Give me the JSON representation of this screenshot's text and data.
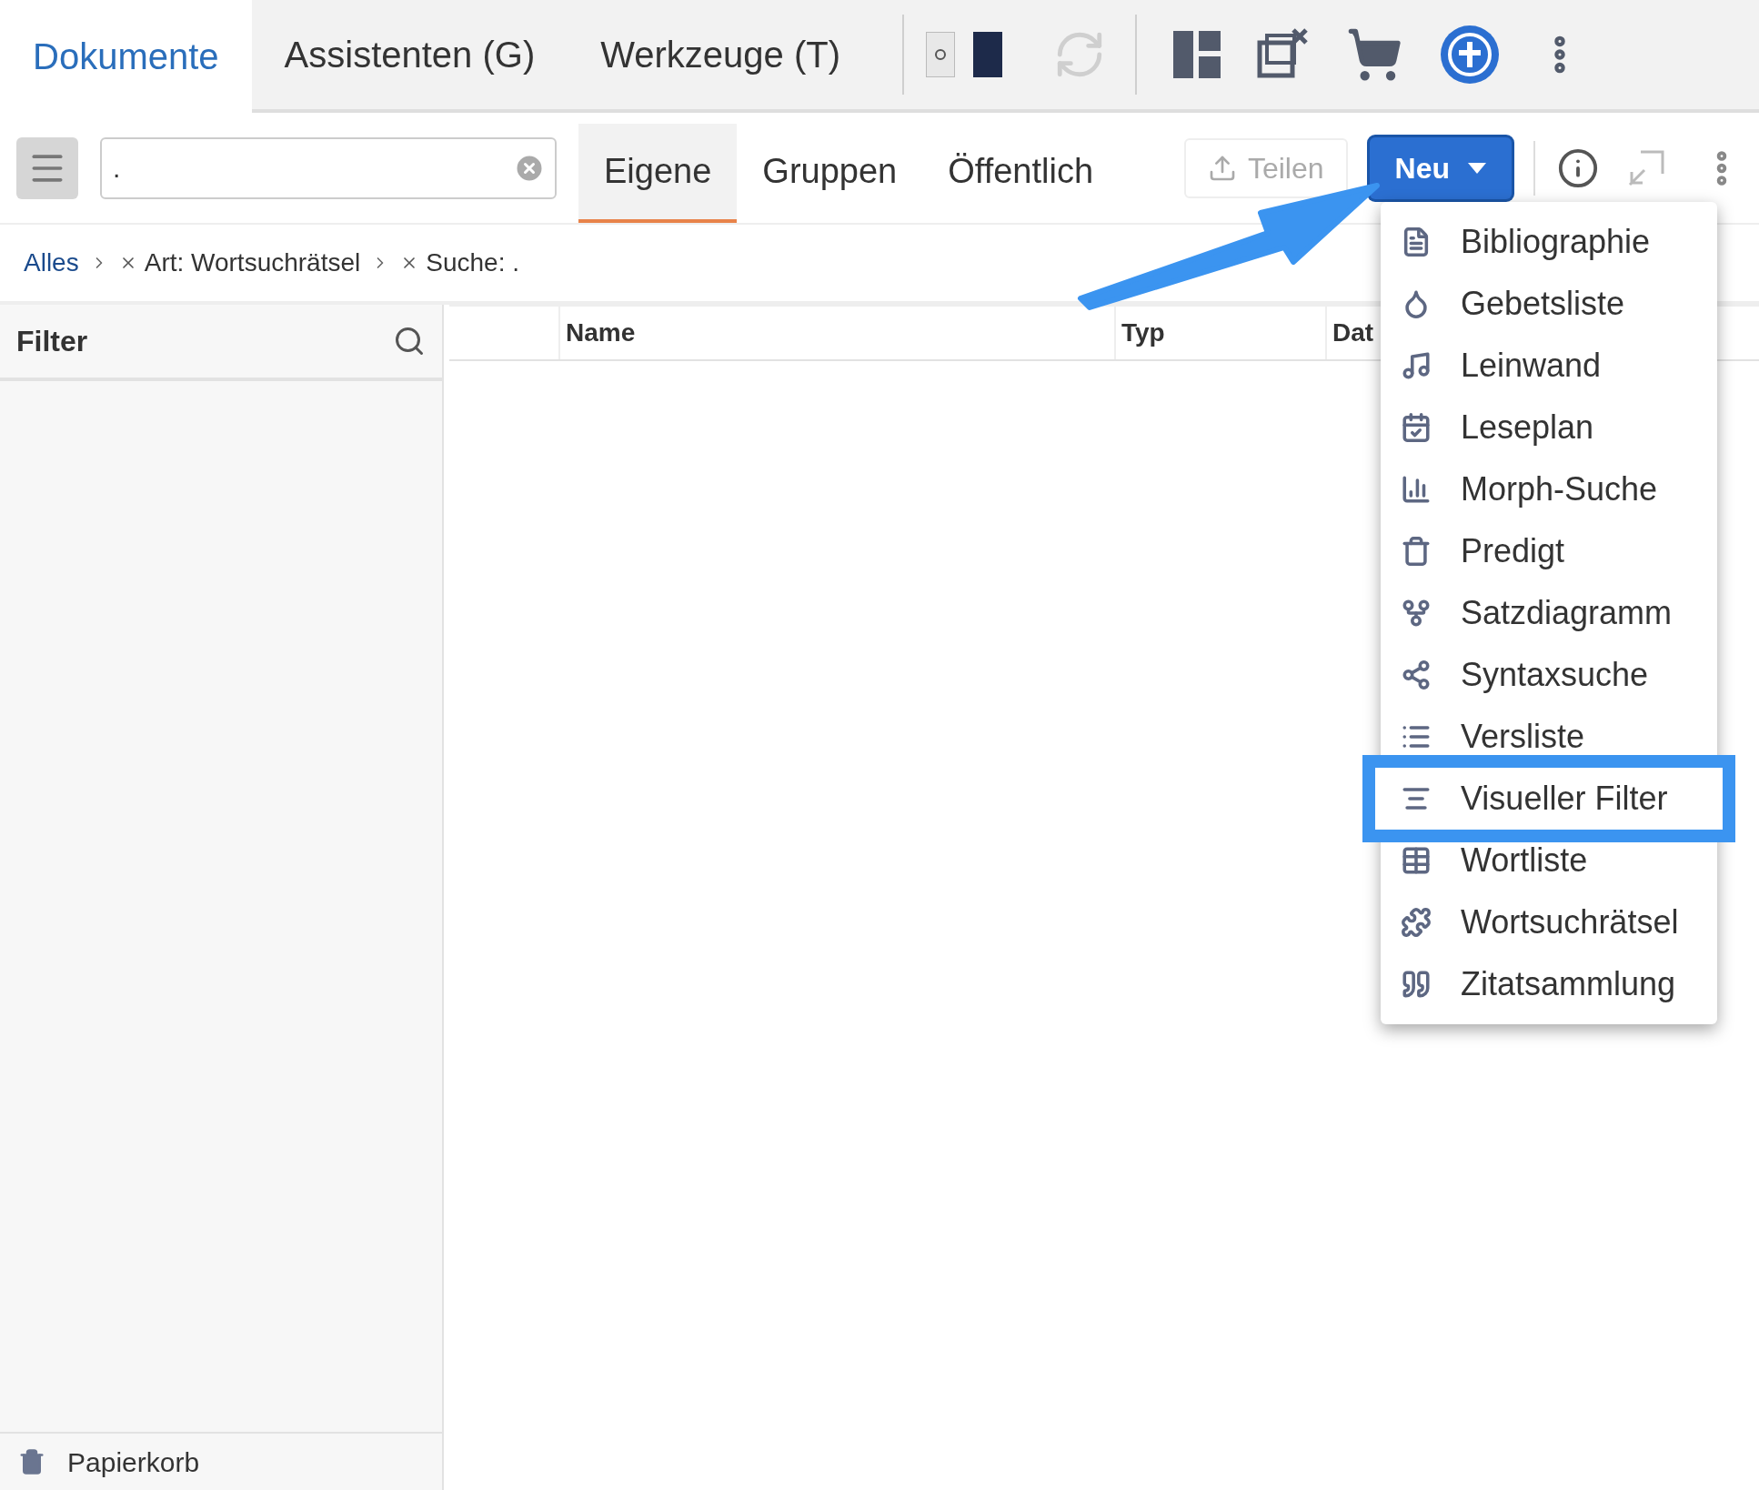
{
  "top_tabs": [
    {
      "label": "Dokumente",
      "selected": true
    },
    {
      "label": "Assistenten (G)",
      "selected": false
    },
    {
      "label": "Werkzeuge (T)",
      "selected": false
    }
  ],
  "search": {
    "value": "."
  },
  "scope_tabs": [
    {
      "label": "Eigene",
      "selected": true
    },
    {
      "label": "Gruppen",
      "selected": false
    },
    {
      "label": "Öffentlich",
      "selected": false
    }
  ],
  "share_button": {
    "label": "Teilen",
    "disabled": true
  },
  "new_button": {
    "label": "Neu",
    "expanded": true
  },
  "breadcrumb": [
    {
      "label": "Alles",
      "kind": "link"
    },
    {
      "label": "Art: Wortsuchrätsel",
      "kind": "filter"
    },
    {
      "label": "Suche: .",
      "kind": "filter"
    }
  ],
  "sidebar": {
    "title": "Filter",
    "footer": "Papierkorb"
  },
  "table": {
    "columns": [
      "Name",
      "Typ",
      "Dat"
    ]
  },
  "new_menu": {
    "items": [
      {
        "label": "Bibliographie",
        "selected": false
      },
      {
        "label": "Gebetsliste",
        "selected": false
      },
      {
        "label": "Leinwand",
        "selected": false
      },
      {
        "label": "Leseplan",
        "selected": false
      },
      {
        "label": "Morph-Suche",
        "selected": false
      },
      {
        "label": "Predigt",
        "selected": false
      },
      {
        "label": "Satzdiagramm",
        "selected": false
      },
      {
        "label": "Syntaxsuche",
        "selected": false
      },
      {
        "label": "Versliste",
        "selected": false
      },
      {
        "label": "Visueller Filter",
        "selected": true
      },
      {
        "label": "Wortliste",
        "selected": false
      },
      {
        "label": "Wortsuchrätsel",
        "selected": false
      },
      {
        "label": "Zitatsammlung",
        "selected": false
      }
    ]
  }
}
